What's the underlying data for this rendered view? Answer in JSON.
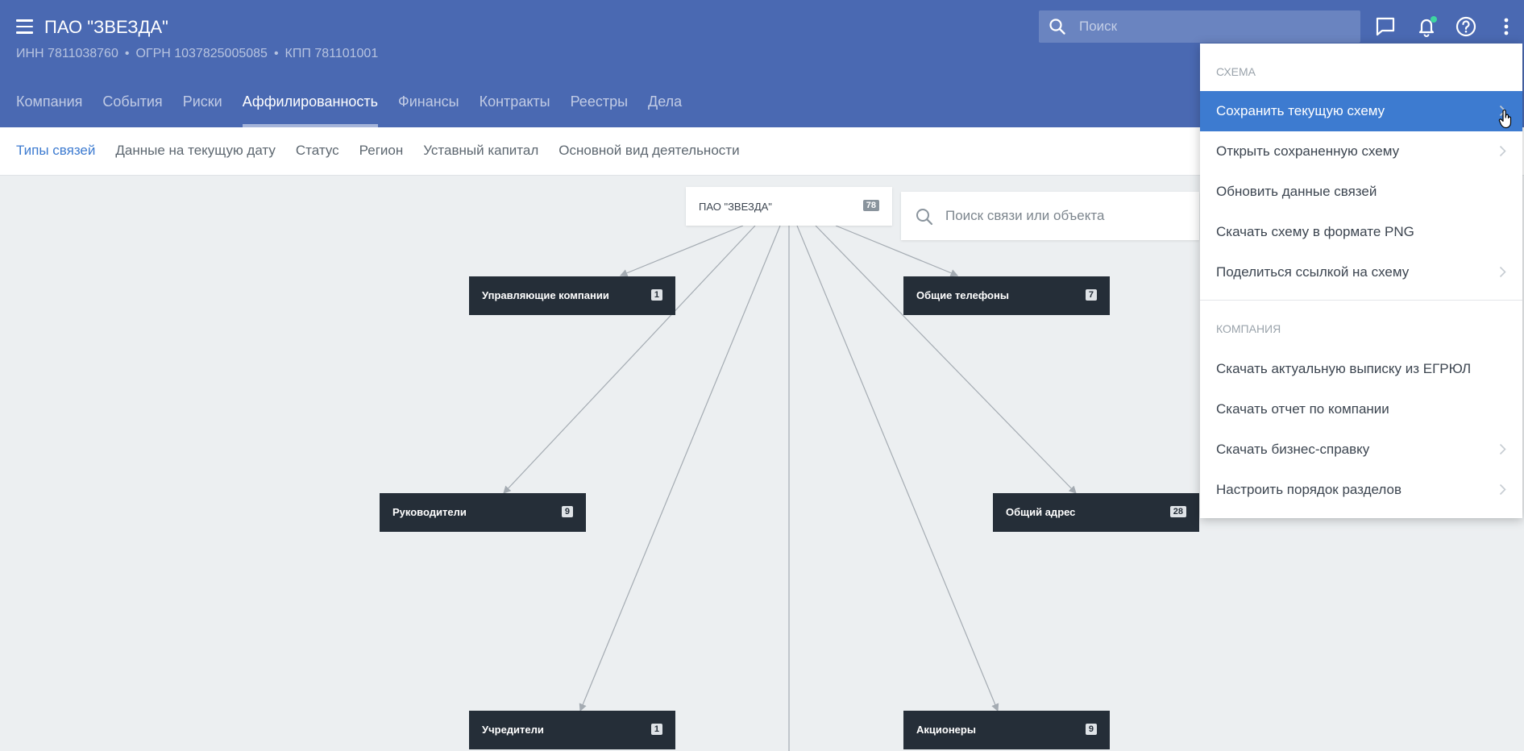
{
  "header": {
    "company_name": "ПАО \"ЗВЕЗДА\"",
    "inn": "ИНН 7811038760",
    "ogrn": "ОГРН 1037825005085",
    "kpp": "КПП 781101001",
    "search_placeholder": "Поиск",
    "icons": [
      "menu-icon",
      "search-icon",
      "chat-icon",
      "bell-icon",
      "help-icon",
      "more-vertical-icon"
    ]
  },
  "tabs": [
    {
      "label": "Компания",
      "active": false
    },
    {
      "label": "События",
      "active": false
    },
    {
      "label": "Риски",
      "active": false
    },
    {
      "label": "Аффилированность",
      "active": true
    },
    {
      "label": "Финансы",
      "active": false
    },
    {
      "label": "Контракты",
      "active": false
    },
    {
      "label": "Реестры",
      "active": false
    },
    {
      "label": "Дела",
      "active": false
    }
  ],
  "subtabs": [
    {
      "label": "Типы связей",
      "active": true
    },
    {
      "label": "Данные на текущую дату",
      "active": false
    },
    {
      "label": "Статус",
      "active": false
    },
    {
      "label": "Регион",
      "active": false
    },
    {
      "label": "Уставный капитал",
      "active": false
    },
    {
      "label": "Основной вид деятельности",
      "active": false
    }
  ],
  "graph": {
    "search_placeholder": "Поиск связи или объекта",
    "root": {
      "label": "ПАО \"ЗВЕЗДА\"",
      "count": "78"
    },
    "nodes": [
      {
        "label": "Управляющие компании",
        "count": "1"
      },
      {
        "label": "Общие телефоны",
        "count": "7"
      },
      {
        "label": "Руководители",
        "count": "9"
      },
      {
        "label": "Общий адрес",
        "count": "28"
      },
      {
        "label": "Учредители",
        "count": "1"
      },
      {
        "label": "Акционеры",
        "count": "9"
      }
    ]
  },
  "menu": {
    "section_scheme": "СХЕМА",
    "section_company": "КОМПАНИЯ",
    "items": [
      {
        "label": "Сохранить текущую схему",
        "has_submenu": true,
        "highlighted": true
      },
      {
        "label": "Открыть сохраненную схему",
        "has_submenu": true,
        "highlighted": false
      },
      {
        "label": "Обновить данные связей",
        "has_submenu": false,
        "highlighted": false
      },
      {
        "label": "Скачать схему в формате PNG",
        "has_submenu": false,
        "highlighted": false
      },
      {
        "label": "Поделиться ссылкой на схему",
        "has_submenu": true,
        "highlighted": false
      },
      {
        "label": "Скачать актуальную выписку из ЕГРЮЛ",
        "has_submenu": false,
        "highlighted": false
      },
      {
        "label": "Скачать отчет по компании",
        "has_submenu": false,
        "highlighted": false
      },
      {
        "label": "Скачать бизнес-справку",
        "has_submenu": true,
        "highlighted": false
      },
      {
        "label": "Настроить порядок разделов",
        "has_submenu": true,
        "highlighted": false
      }
    ]
  },
  "colors": {
    "header_bg": "#4a69b2",
    "accent": "#3d7bd0",
    "node_bg": "#252e38",
    "canvas_bg": "#eceff1",
    "notification": "#3ed6a0"
  }
}
